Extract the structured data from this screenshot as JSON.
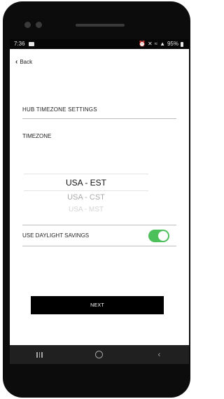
{
  "status_bar": {
    "time": "7:36",
    "battery": "95%",
    "icons": [
      "alarm-icon",
      "mute-icon",
      "wifi-icon",
      "signal-icon",
      "battery-icon"
    ]
  },
  "header": {
    "back_label": "Back"
  },
  "hub_settings": {
    "title": "HUB TIMEZONE SETTINGS"
  },
  "timezone": {
    "label": "TIMEZONE",
    "options": [
      "USA - EST",
      "USA - CST",
      "USA - MST"
    ],
    "selected": "USA - EST"
  },
  "daylight_savings": {
    "label": "USE DAYLIGHT SAVINGS",
    "enabled": true
  },
  "actions": {
    "next_label": "NEXT"
  },
  "colors": {
    "toggle_on": "#4cc05a",
    "button_bg": "#000000",
    "nav_bar": "#202020"
  }
}
